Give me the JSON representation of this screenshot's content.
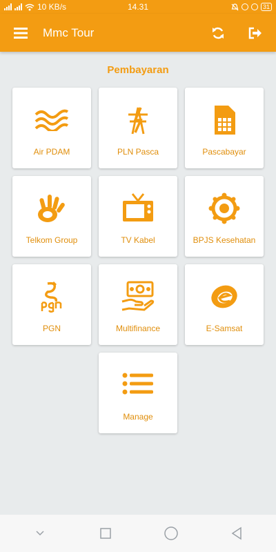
{
  "status_bar": {
    "network_speed": "10 KB/s",
    "time": "14.31",
    "battery": "31"
  },
  "app_bar": {
    "title": "Mmc Tour"
  },
  "section_title": "Pembayaran",
  "items": [
    {
      "label": "Air PDAM",
      "icon": "water-waves-icon"
    },
    {
      "label": "PLN Pasca",
      "icon": "electric-tower-icon"
    },
    {
      "label": "Pascabayar",
      "icon": "sim-card-icon"
    },
    {
      "label": "Telkom Group",
      "icon": "telkom-hand-icon"
    },
    {
      "label": "TV Kabel",
      "icon": "tv-icon"
    },
    {
      "label": "BPJS Kesehatan",
      "icon": "bpjs-logo-icon"
    },
    {
      "label": "PGN",
      "icon": "pgn-logo-icon"
    },
    {
      "label": "Multifinance",
      "icon": "money-hand-icon"
    },
    {
      "label": "E-Samsat",
      "icon": "e-samsat-icon"
    },
    {
      "label": "Manage",
      "icon": "list-icon"
    }
  ],
  "colors": {
    "accent": "#f39c12",
    "label": "#e08e0b",
    "background": "#e8ebec"
  }
}
